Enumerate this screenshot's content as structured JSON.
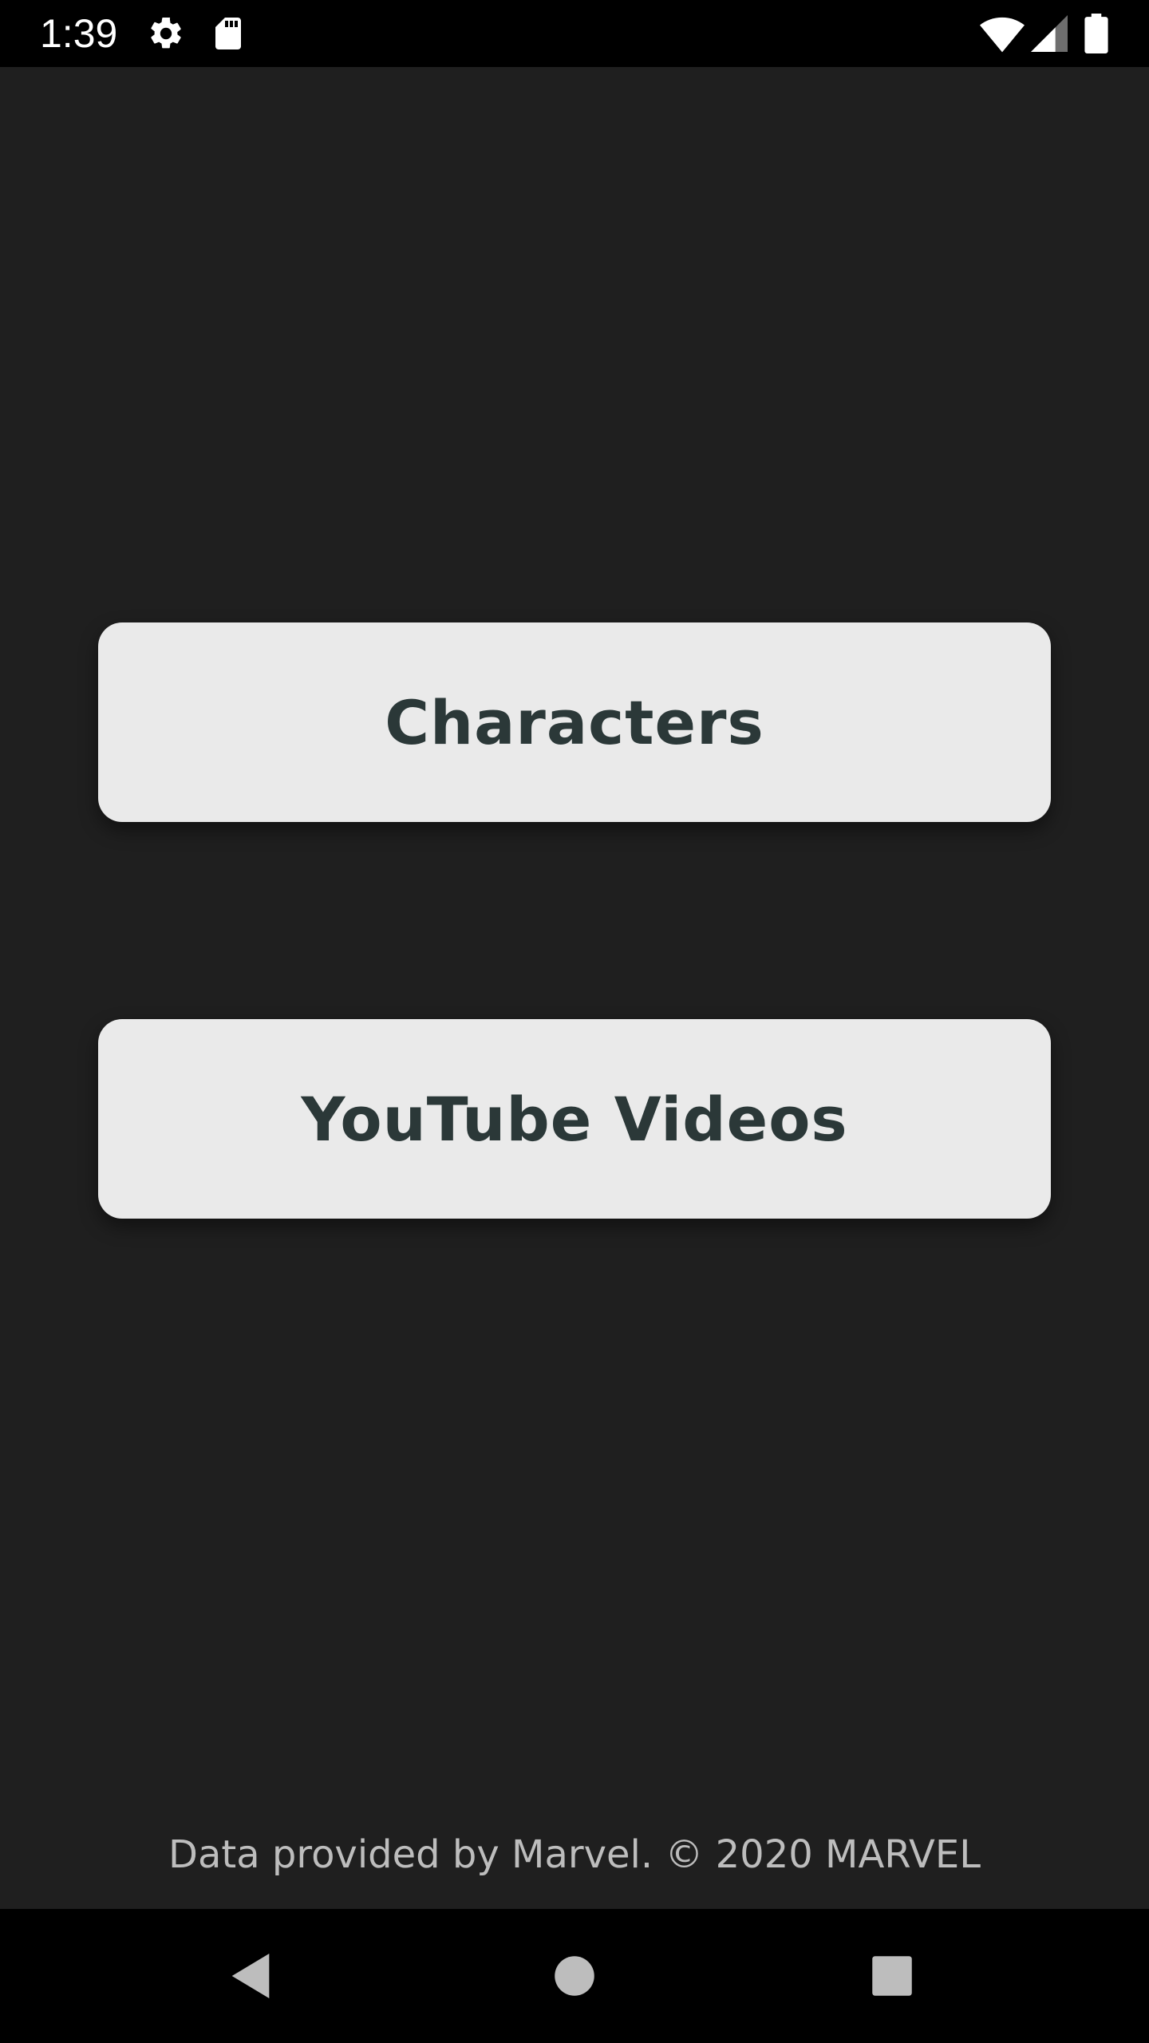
{
  "status_bar": {
    "time": "1:39",
    "icons": [
      "gear-icon",
      "sd-card-icon",
      "wifi-icon",
      "signal-icon",
      "battery-icon"
    ]
  },
  "main": {
    "buttons": [
      {
        "label": "Characters"
      },
      {
        "label": "YouTube Videos"
      }
    ],
    "attribution": "Data provided by Marvel. © 2020 MARVEL"
  },
  "nav_bar": {
    "icons": [
      "back-icon",
      "home-icon",
      "recents-icon"
    ]
  },
  "colors": {
    "background": "#1f1f1f",
    "button_bg": "#eaeaea",
    "button_text": "#2b3838",
    "bar_bg": "#000000",
    "attribution_text": "#bdbdbd"
  }
}
